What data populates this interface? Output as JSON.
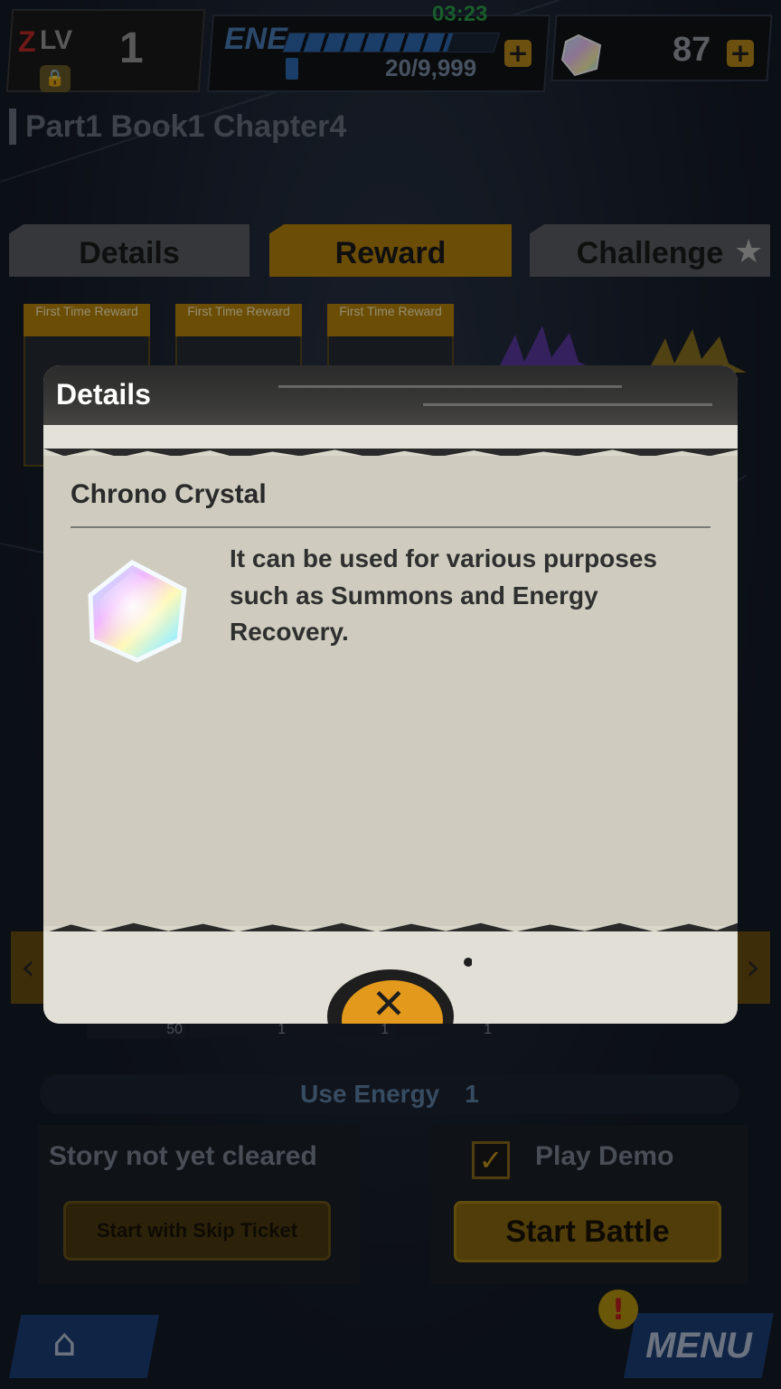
{
  "hud": {
    "level_prefix": "Z",
    "level_label": "LV",
    "level_value": "1",
    "energy_label": "ENE",
    "energy_timer": "03:23",
    "energy_count": "20/9,999",
    "energy_fill_fraction": 0.78,
    "chrono_crystal_count": "87",
    "plus_symbol": "+"
  },
  "chapter": {
    "title": "Part1 Book1 Chapter4"
  },
  "tabs": [
    {
      "label": "Details",
      "active": false
    },
    {
      "label": "Reward",
      "active": true
    },
    {
      "label": "Challenge",
      "active": false
    }
  ],
  "rewards": [
    {
      "banner": "First Time Reward"
    },
    {
      "banner": "First Time Reward"
    },
    {
      "banner": "First Time Reward"
    }
  ],
  "lower": {
    "slots": [
      "50",
      "1",
      "1",
      "1"
    ],
    "use_energy_label": "Use Energy",
    "use_energy_value": "1",
    "story_status": "Story not yet cleared",
    "skip_ticket_label": "Start with Skip Ticket",
    "play_demo_label": "Play Demo",
    "play_demo_checked": true,
    "start_battle_label": "Start Battle",
    "menu_label": "MENU",
    "alert_symbol": "!"
  },
  "modal": {
    "title": "Details",
    "item_name": "Chrono Crystal",
    "description": "It can be used for various purposes such as Summons and Energy Recovery.",
    "close_symbol": "✕"
  },
  "colors": {
    "accent_gold": "#b8860b",
    "energy_blue": "#2e6bb3",
    "timer_green": "#2aa04a",
    "modal_bg": "#d9d6ca",
    "menu_blue": "#1d3e78"
  },
  "icons": {
    "lock": "lock-icon",
    "chrono_crystal": "chrono-crystal-icon",
    "star": "star-icon",
    "home": "home-icon",
    "check": "check-icon",
    "close": "close-icon"
  }
}
